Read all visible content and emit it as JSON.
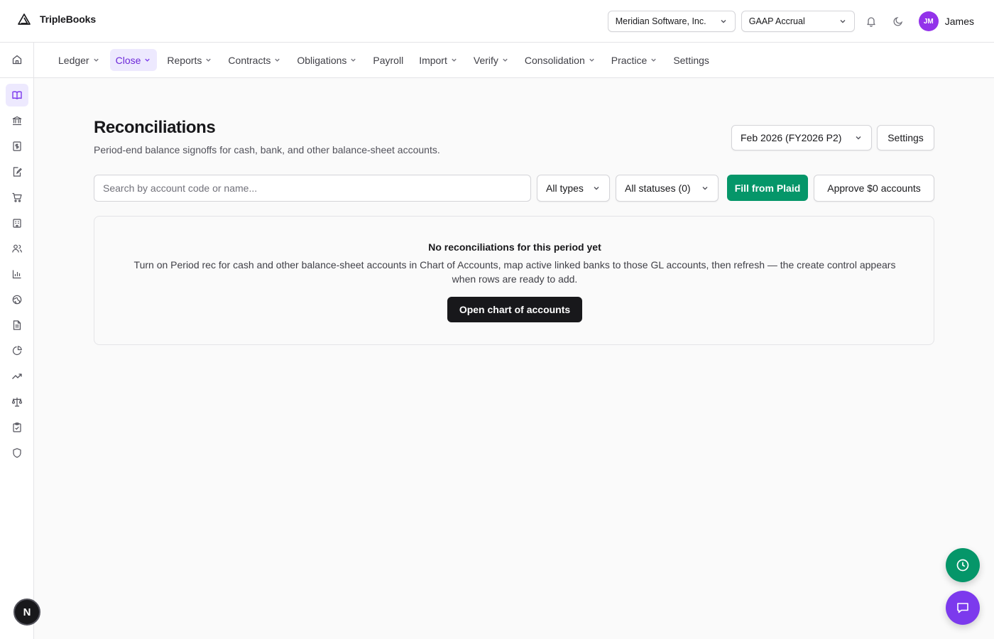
{
  "app": {
    "name": "TripleBooks"
  },
  "header": {
    "entity_select": "Meridian Software, Inc.",
    "basis_select": "GAAP Accrual",
    "user": {
      "initials": "JM",
      "name": "James"
    }
  },
  "rail": {
    "items": [
      "home-icon",
      "book-icon",
      "bank-icon",
      "dollar-file-icon",
      "edit-file-icon",
      "cart-icon",
      "building-icon",
      "users-icon",
      "bar-chart-icon",
      "globe-icon",
      "document-icon",
      "pie-chart-icon",
      "trend-icon",
      "scale-icon",
      "clipboard-check-icon",
      "shield-icon"
    ],
    "active": "book-icon",
    "bottom_badge": "N"
  },
  "nav": {
    "tabs": [
      {
        "label": "Ledger",
        "dropdown": true
      },
      {
        "label": "Close",
        "dropdown": true,
        "active": true
      },
      {
        "label": "Reports",
        "dropdown": true
      },
      {
        "label": "Contracts",
        "dropdown": true
      },
      {
        "label": "Obligations",
        "dropdown": true
      },
      {
        "label": "Payroll",
        "dropdown": false
      },
      {
        "label": "Import",
        "dropdown": true
      },
      {
        "label": "Verify",
        "dropdown": true
      },
      {
        "label": "Consolidation",
        "dropdown": true
      },
      {
        "label": "Practice",
        "dropdown": true
      },
      {
        "label": "Settings",
        "dropdown": false
      }
    ]
  },
  "page": {
    "title": "Reconciliations",
    "subtitle": "Period-end balance signoffs for cash, bank, and other balance-sheet accounts.",
    "period_select": "Feb 2026 (FY2026 P2)",
    "settings_label": "Settings"
  },
  "toolbar": {
    "search_placeholder": "Search by account code or name...",
    "type_filter": "All types",
    "status_filter": "All statuses (0)",
    "plaid_label": "Fill from Plaid",
    "approve_label": "Approve $0 accounts"
  },
  "empty_state": {
    "title": "No reconciliations for this period yet",
    "body": "Turn on Period rec for cash and other balance-sheet accounts in Chart of Accounts, map active linked banks to those GL accounts, then refresh — the create control appears when rows are ready to add.",
    "button_label": "Open chart of accounts"
  },
  "colors": {
    "accent": "#7c3aed",
    "accent_bg": "#ede9fe",
    "success": "#059669",
    "avatar": "#9333ea",
    "dark_button": "#18181b"
  }
}
